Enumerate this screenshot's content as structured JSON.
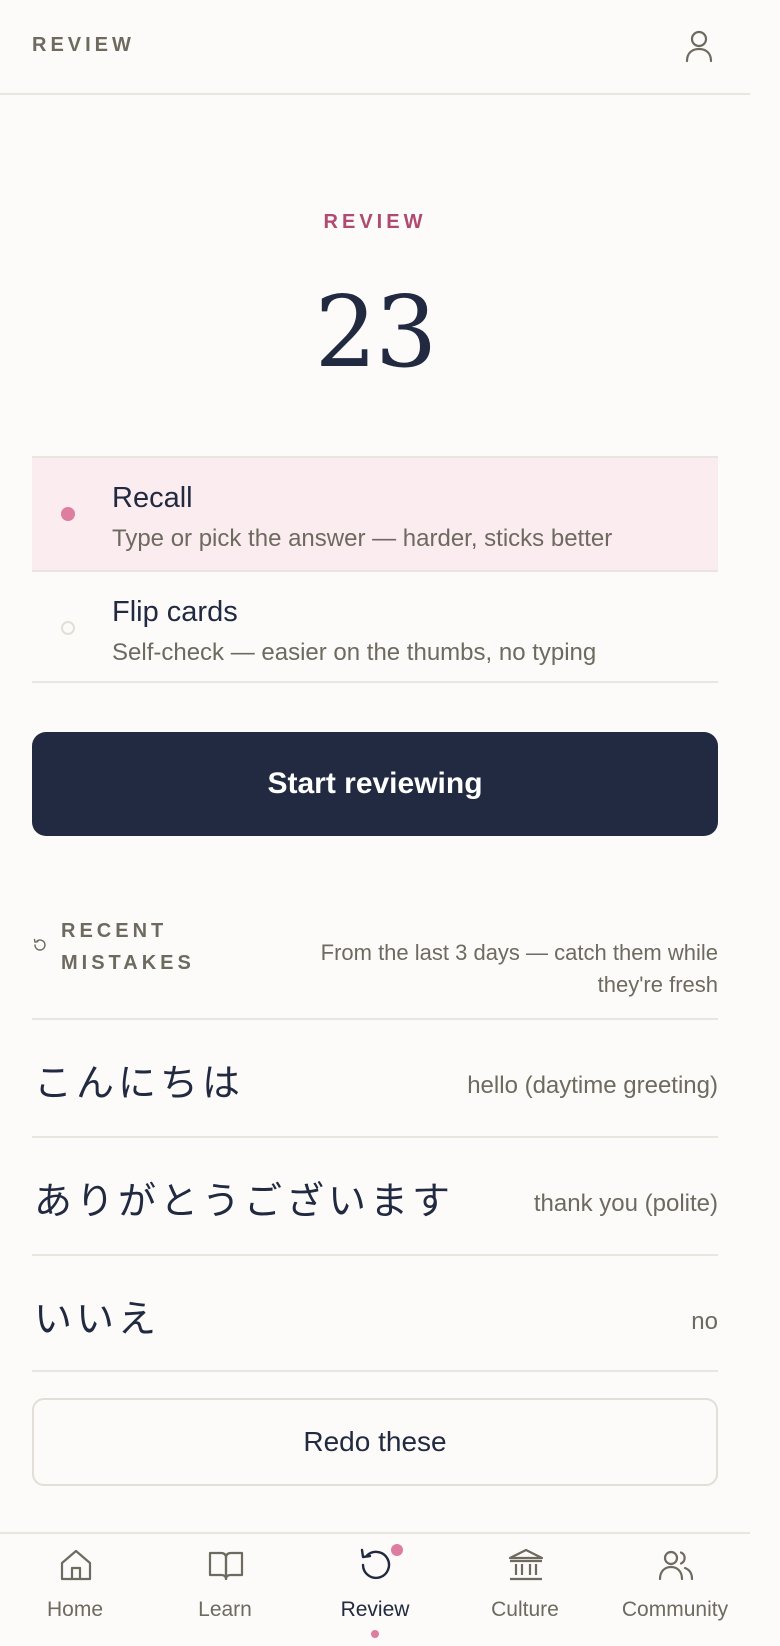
{
  "header": {
    "title": "REVIEW",
    "profile_icon": "user-icon"
  },
  "summary": {
    "eyebrow": "REVIEW",
    "count": "23"
  },
  "modes": [
    {
      "title": "Recall",
      "description": "Type or pick the answer — harder, sticks better",
      "selected": true
    },
    {
      "title": "Flip cards",
      "description": "Self-check — easier on the thumbs, no typing",
      "selected": false
    }
  ],
  "start_button": "Start reviewing",
  "mistakes": {
    "label": "RECENT MISTAKES",
    "note": "From the last 3 days — catch them while they're fresh",
    "icon": "refresh-icon",
    "items": [
      {
        "word": "こんにちは",
        "meaning": "hello (daytime greeting)"
      },
      {
        "word": "ありがとうございます",
        "meaning": "thank you (polite)"
      },
      {
        "word": "いいえ",
        "meaning": "no"
      }
    ],
    "redo_button": "Redo these"
  },
  "nav": {
    "items": [
      {
        "label": "Home",
        "icon": "home-icon"
      },
      {
        "label": "Learn",
        "icon": "book-icon"
      },
      {
        "label": "Review",
        "icon": "review-icon",
        "active": true,
        "badge": true
      },
      {
        "label": "Culture",
        "icon": "museum-icon"
      },
      {
        "label": "Community",
        "icon": "people-icon"
      }
    ]
  },
  "colors": {
    "background": "#fcfbf9",
    "ink": "#212a40",
    "muted": "#6f6a60",
    "accent": "#b04a70",
    "accent_dot": "#de7d9f",
    "selected_bg": "#faecef",
    "divider": "#e9e5df"
  }
}
